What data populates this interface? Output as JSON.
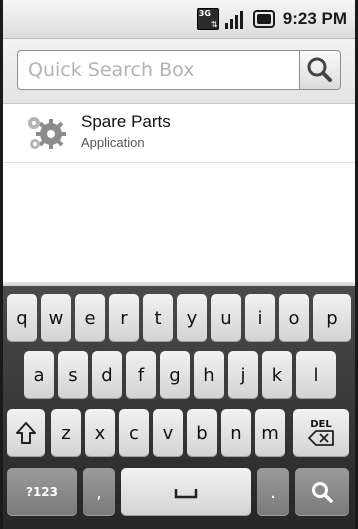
{
  "status_bar": {
    "network_badge": "3G",
    "time": "9:23 PM",
    "icons": [
      "3g-data-icon",
      "signal-strength-icon",
      "battery-icon"
    ]
  },
  "search": {
    "placeholder": "Quick Search Box",
    "icon": "search-icon"
  },
  "results": [
    {
      "title": "Spare Parts",
      "subtitle": "Application",
      "icon": "gears-icon"
    }
  ],
  "keyboard": {
    "row1": [
      "q",
      "w",
      "e",
      "r",
      "t",
      "y",
      "u",
      "i",
      "o",
      "p"
    ],
    "row2": [
      "a",
      "s",
      "d",
      "f",
      "g",
      "h",
      "j",
      "k",
      "l"
    ],
    "row3": [
      "z",
      "x",
      "c",
      "v",
      "b",
      "n",
      "m"
    ],
    "shift_icon": "shift-icon",
    "delete_label": "DEL",
    "symbols_label": "?123",
    "comma": ",",
    "period": ".",
    "space_icon": "space-icon",
    "search_key_icon": "search-icon"
  }
}
